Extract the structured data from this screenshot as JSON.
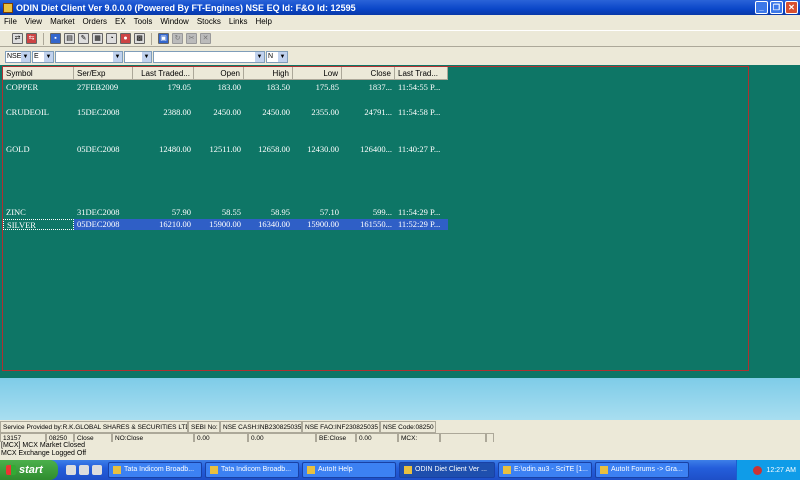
{
  "window": {
    "title": "ODIN  Diet Client Ver 9.0.0.0 (Powered By FT-Engines)  NSE EQ Id:    F&O Id: 12595"
  },
  "menu": [
    "File",
    "View",
    "Market",
    "Orders",
    "EX",
    "Tools",
    "Window",
    "Stocks",
    "Links",
    "Help"
  ],
  "filters": {
    "exchange": "NSE",
    "segment": "E",
    "series_flag": "N"
  },
  "columns": [
    "Symbol",
    "Ser/Exp",
    "Last Traded...",
    "Open",
    "High",
    "Low",
    "Close",
    "Last Trad..."
  ],
  "rows": [
    [
      "COPPER",
      "27FEB2009",
      "179.05",
      "183.00",
      "183.50",
      "175.85",
      "1837...",
      "11:54:55 P..."
    ],
    [
      "CRUDEOIL",
      "15DEC2008",
      "2388.00",
      "2450.00",
      "2450.00",
      "2355.00",
      "24791...",
      "11:54:58 P..."
    ],
    [
      "GOLD",
      "05DEC2008",
      "12480.00",
      "12511.00",
      "12658.00",
      "12430.00",
      "126400...",
      "11:40:27 P..."
    ],
    [
      "ZINC",
      "31DEC2008",
      "57.90",
      "58.55",
      "58.95",
      "57.10",
      "599...",
      "11:54:29 P..."
    ],
    [
      "SILVER",
      "05DEC2008",
      "16210.00",
      "15900.00",
      "16340.00",
      "15900.00",
      "161550...",
      "11:52:29 P..."
    ]
  ],
  "status1": [
    "Service Provided by:R.K.GLOBAL SHARES & SECURITIES LTD",
    "SEBI No:",
    "NSE CASH:INB230825035",
    "NSE FAO:INF230825035",
    "NSE Code:08250"
  ],
  "status2": [
    "13157",
    "08250",
    "Close",
    "NO:Close",
    "0.00",
    "0.00",
    "BE:Close",
    "0.00",
    "MCX:"
  ],
  "messages": [
    "[MCX] MCX Market Closed",
    "MCX Exchange Logged Off"
  ],
  "taskbar": {
    "start": "start",
    "tasks": [
      "Tata Indicom Broadb...",
      "Tata Indicom Broadb...",
      "AutoIt Help",
      "ODIN  Diet Client Ver ...",
      "E:\\odin.au3 - SciTE [1...",
      "AutoIt Forums -> Gra..."
    ],
    "clock": "12:27 AM"
  }
}
